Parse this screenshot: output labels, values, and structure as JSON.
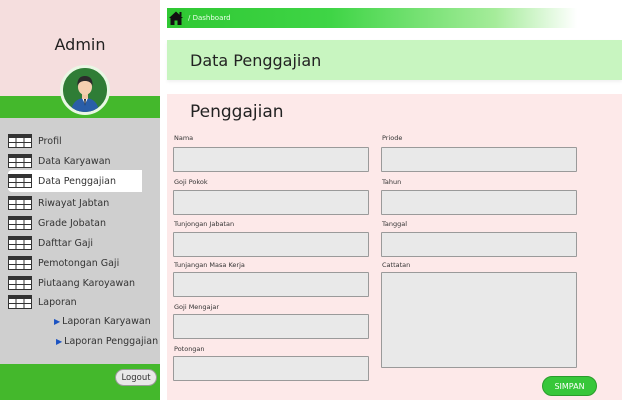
{
  "sidebar": {
    "admin_label": "Admin",
    "items": [
      {
        "label": "Profil"
      },
      {
        "label": "Data Karyawan"
      },
      {
        "label": "Data Penggajian"
      },
      {
        "label": "Riwayat Jabtan"
      },
      {
        "label": "Grade Jobatan"
      },
      {
        "label": "Dafttar Gaji"
      },
      {
        "label": "Pemotongan Gaji"
      },
      {
        "label": "Piutaang Karoyawan"
      },
      {
        "label": "Laporan"
      }
    ],
    "sub_items": [
      {
        "label": "Laporan Karyawan"
      },
      {
        "label": "Laporan  Penggajian"
      }
    ],
    "active_index": 2,
    "logout_label": "Logout"
  },
  "breadcrumb": {
    "text": "/ Dashboard"
  },
  "header": {
    "title": "Data Penggajian"
  },
  "form": {
    "title": "Penggajian",
    "left_fields": [
      {
        "label": "Nama",
        "value": ""
      },
      {
        "label": "Goji Pokok",
        "value": ""
      },
      {
        "label": "Tunjongan Jabatan",
        "value": ""
      },
      {
        "label": "Tunjangan Masa Kerja",
        "value": ""
      },
      {
        "label": "Goji Mengajar",
        "value": ""
      },
      {
        "label": "Potongan",
        "value": ""
      }
    ],
    "right_fields": [
      {
        "label": "Priode",
        "value": ""
      },
      {
        "label": "Tahun",
        "value": ""
      },
      {
        "label": "Tanggal",
        "value": ""
      },
      {
        "label": "Cattatan",
        "value": ""
      }
    ],
    "submit_label": "SIMPAN"
  },
  "colors": {
    "sidebar_green": "#44b82c",
    "sidebar_pink": "#f5dede",
    "nav_gray": "#cfcfcf",
    "header_green": "#c8f5c0",
    "card_pink": "#fde9e9",
    "button_green": "#37c73a"
  },
  "icons": {
    "nav": "table-icon",
    "home": "home-icon",
    "avatar": "user-avatar-icon",
    "submenu": "triangle-right-icon"
  }
}
